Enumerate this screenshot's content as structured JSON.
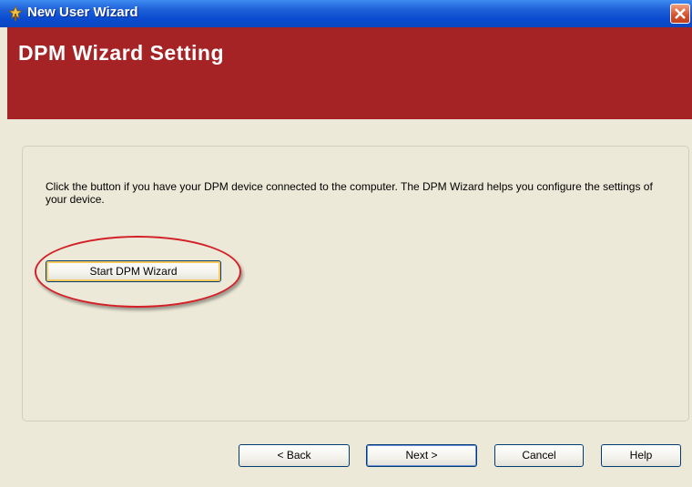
{
  "window": {
    "title": "New User Wizard",
    "icon": "wizard-icon",
    "close_icon": "close-icon"
  },
  "header": {
    "title": "DPM Wizard Setting",
    "color": "#a52225"
  },
  "content": {
    "description": "Click the button if you have your DPM device connected to the computer. The DPM Wizard helps you configure the settings of your device.",
    "start_button": "Start DPM Wizard",
    "highlight_color": "#d32027"
  },
  "footer": {
    "back": "< Back",
    "next": "Next >",
    "cancel": "Cancel",
    "help": "Help"
  }
}
